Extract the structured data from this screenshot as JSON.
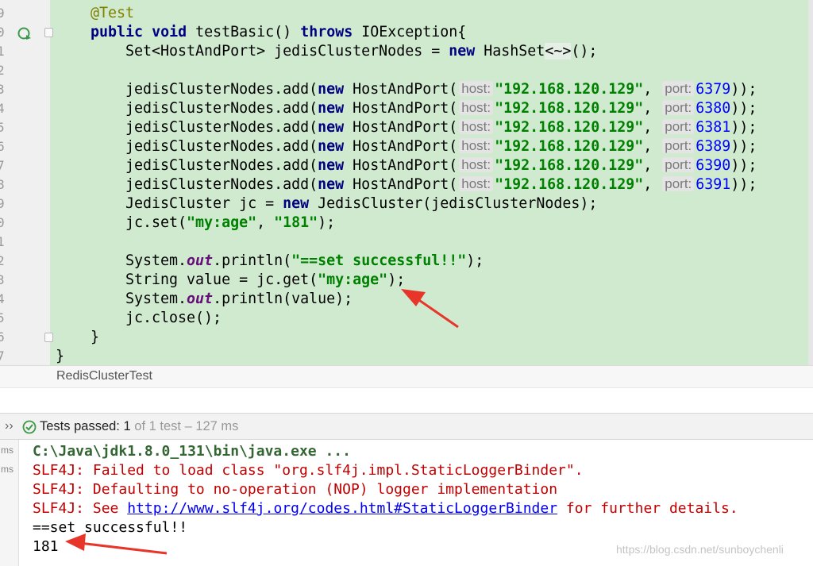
{
  "editor": {
    "line_numbers": [
      "9",
      "0",
      "1",
      "2",
      "3",
      "4",
      "5",
      "6",
      "7",
      "8",
      "9",
      "0",
      "1",
      "2",
      "3",
      "4",
      "5",
      "6",
      "7"
    ],
    "host_hint": "host:",
    "port_hint": "port:",
    "host_value": "\"192.168.120.129\"",
    "ports": [
      "6379",
      "6380",
      "6381",
      "6389",
      "6390",
      "6391"
    ],
    "annotation": "@Test",
    "method_kw1": "public",
    "method_kw2": "void",
    "method_name": " testBasic() ",
    "throws_kw": "throws",
    "exception": " IOException{",
    "set_decl": "Set<HostAndPort> jedisClusterNodes = ",
    "new_kw": "new",
    "hashset": " HashSet",
    "diamond": "<~>",
    "hashset_end": "();",
    "add_prefix": "jedisClusterNodes.add(",
    "hostandport": " HostAndPort(",
    "comma": ", ",
    "add_suffix": "));",
    "cluster_decl": "JedisCluster jc = ",
    "cluster_ctor": " JedisCluster(jedisClusterNodes);",
    "set_call_a": "jc.set(",
    "key_str": "\"my:age\"",
    "set_call_comma": ", ",
    "value_str": "\"181\"",
    "set_call_end": ");",
    "system": "System.",
    "out": "out",
    "println_a": ".println(",
    "success_str": "\"==set successful!!\"",
    "paren_semi": ");",
    "string_decl": "String value = jc.get(",
    "println_value": ".println(value);",
    "close_call": "jc.close();",
    "close_brace": "}"
  },
  "breadcrumb": {
    "label": "RedisClusterTest"
  },
  "testbar": {
    "label": "Tests passed:",
    "count_passed": "1",
    "of_total": "of 1 test",
    "duration": "– 127 ms"
  },
  "console": {
    "gutter_labels": [
      "ms",
      "ms"
    ],
    "cmd": "C:\\Java\\jdk1.8.0_131\\bin\\java.exe ...",
    "err1": "SLF4J: Failed to load class \"org.slf4j.impl.StaticLoggerBinder\".",
    "err2": "SLF4J: Defaulting to no-operation (NOP) logger implementation",
    "err3_prefix": "SLF4J: See ",
    "err3_link": "http://www.slf4j.org/codes.html#StaticLoggerBinder",
    "err3_suffix": " for further details.",
    "out1": "==set successful!!",
    "out2": "181",
    "watermark": "https://blog.csdn.net/sunboychenli"
  },
  "colors": {
    "code_bg": "#cfeacf",
    "keyword": "#000080",
    "string": "#008000",
    "number": "#0000ff",
    "annotation": "#808000",
    "error_text": "#c00000",
    "arrow": "#e8352a"
  }
}
